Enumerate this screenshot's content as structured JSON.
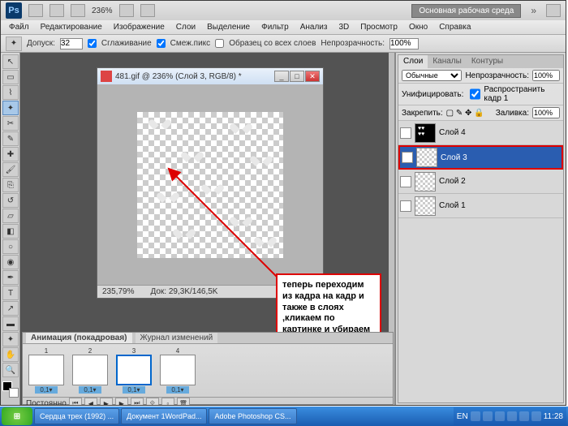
{
  "topbar": {
    "zoom": "236%",
    "workspace": "Основная рабочая среда"
  },
  "menu": [
    "Файл",
    "Редактирование",
    "Изображение",
    "Слои",
    "Выделение",
    "Фильтр",
    "Анализ",
    "3D",
    "Просмотр",
    "Окно",
    "Справка"
  ],
  "options": {
    "tolerance_label": "Допуск:",
    "tolerance_value": "32",
    "antialias": "Сглаживание",
    "contiguous": "Смеж.пикс",
    "all_layers": "Образец со всех слоев",
    "opacity_label": "Непрозрачность:",
    "opacity_value": "100%"
  },
  "document": {
    "title": "481.gif @ 236% (Слой 3, RGB/8) *",
    "status_zoom": "235,79%",
    "status_doc": "Док: 29,3K/146,5K"
  },
  "annotation": "теперь переходим из кадра на кадр и также в слоях ,кликаем по картинке и убираем чёрный цвет",
  "animation": {
    "tab1": "Анимация (покадровая)",
    "tab2": "Журнал изменений",
    "frames": [
      {
        "n": "1",
        "t": "0,1▾",
        "cls": "th-check"
      },
      {
        "n": "2",
        "t": "0,1▾",
        "cls": "th-check"
      },
      {
        "n": "3",
        "t": "0,1▾",
        "cls": "th-check",
        "sel": true
      },
      {
        "n": "4",
        "t": "0,1▾",
        "cls": "th-black"
      }
    ],
    "loop": "Постоянно"
  },
  "layers_panel": {
    "tabs": [
      "Слои",
      "Каналы",
      "Контуры"
    ],
    "blend": "Обычные",
    "opacity_label": "Непрозрачность:",
    "opacity": "100%",
    "unify_label": "Унифицировать:",
    "propagate": "Распространить кадр 1",
    "lock_label": "Закрепить:",
    "fill_label": "Заливка:",
    "fill": "100%",
    "layers": [
      {
        "name": "Слой 4",
        "cls": "lth-black"
      },
      {
        "name": "Слой 3",
        "cls": "lth-check",
        "sel": true
      },
      {
        "name": "Слой 2",
        "cls": "lth-check"
      },
      {
        "name": "Слой 1",
        "cls": "lth-check"
      }
    ]
  },
  "taskbar": {
    "tasks": [
      "Сердца трех (1992) ...",
      "Документ 1WordPad...",
      "Adobe Photoshop CS..."
    ],
    "lang": "EN",
    "time": "11:28"
  }
}
